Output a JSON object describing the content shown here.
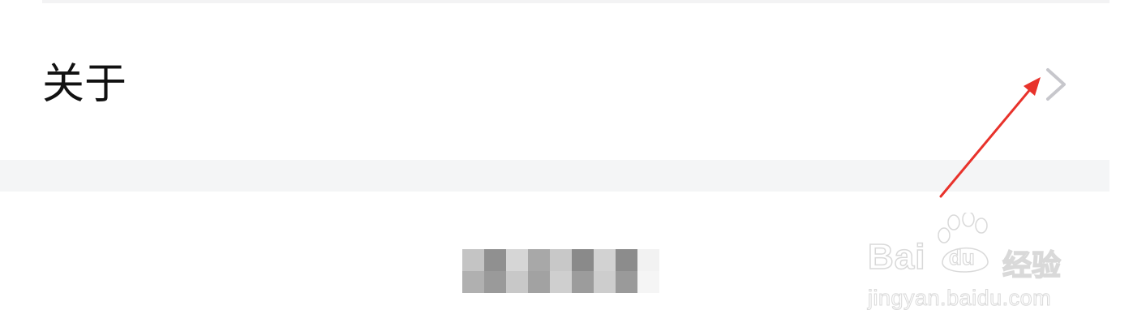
{
  "settings": {
    "about_row": {
      "label": "关于",
      "chevron_icon": "chevron-right-icon"
    }
  },
  "footer": {
    "version_text_obscured": true,
    "pixelation_colors": [
      [
        "#c4c4c4",
        "#909090",
        "#d6d6d6",
        "#a8a8a8",
        "#c8c8c8",
        "#8a8a8a",
        "#d2d2d2",
        "#8c8c8c",
        "#f2f2f2"
      ],
      [
        "#b0b0b0",
        "#9a9a9a",
        "#c8c8c8",
        "#a2a2a2",
        "#cfcfcf",
        "#9c9c9c",
        "#cdcdcd",
        "#9a9a9a",
        "#f5f5f5"
      ]
    ]
  },
  "annotation": {
    "type": "red-arrow",
    "color": "#e8322b"
  },
  "watermark": {
    "logo": "Bai",
    "paw_text": "du",
    "jingyan": "经验",
    "url": "jingyan.baidu.com"
  },
  "colors": {
    "background": "#ffffff",
    "section_gap": "#f4f5f6",
    "chevron": "#c7c7cc",
    "label_text": "#111111"
  }
}
